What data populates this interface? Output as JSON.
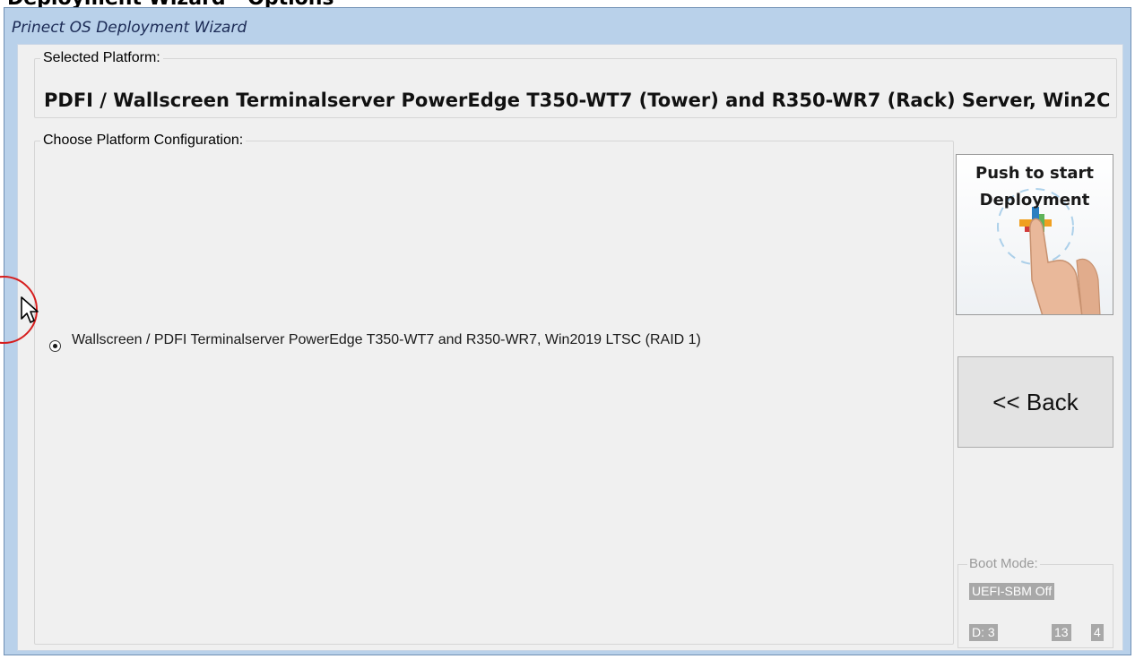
{
  "page_header": "Deployment Wizard - Options",
  "window": {
    "title": "Prinect OS Deployment  Wizard"
  },
  "selected_platform": {
    "legend": "Selected Platform:",
    "value": "PDFI / Wallscreen Terminalserver PowerEdge T350-WT7 (Tower) and R350-WR7 (Rack) Server, Win2C"
  },
  "platform_configuration": {
    "legend": "Choose Platform Configuration:",
    "options": [
      {
        "label": "Wallscreen / PDFI Terminalserver PowerEdge T350-WT7 and R350-WR7, Win2019 LTSC (RAID 1)",
        "selected": true
      }
    ]
  },
  "buttons": {
    "deploy_line1": "Push to start",
    "deploy_line2": "Deployment",
    "back": "<< Back"
  },
  "boot_mode": {
    "legend": "Boot Mode:",
    "value": "UEFI-SBM Off",
    "d_label": "D: 3",
    "num1": "13",
    "num2": "4"
  },
  "colors": {
    "window_frame": "#b9d1ea",
    "client_bg": "#f0f0f0",
    "legend_blue": "#1f5fb3",
    "annotation_red": "#d61e1e",
    "badge_gray": "#a8a8a8"
  },
  "icons": [
    "mouse-pointer-icon",
    "radio-selected-icon",
    "hand-touch-icon"
  ]
}
